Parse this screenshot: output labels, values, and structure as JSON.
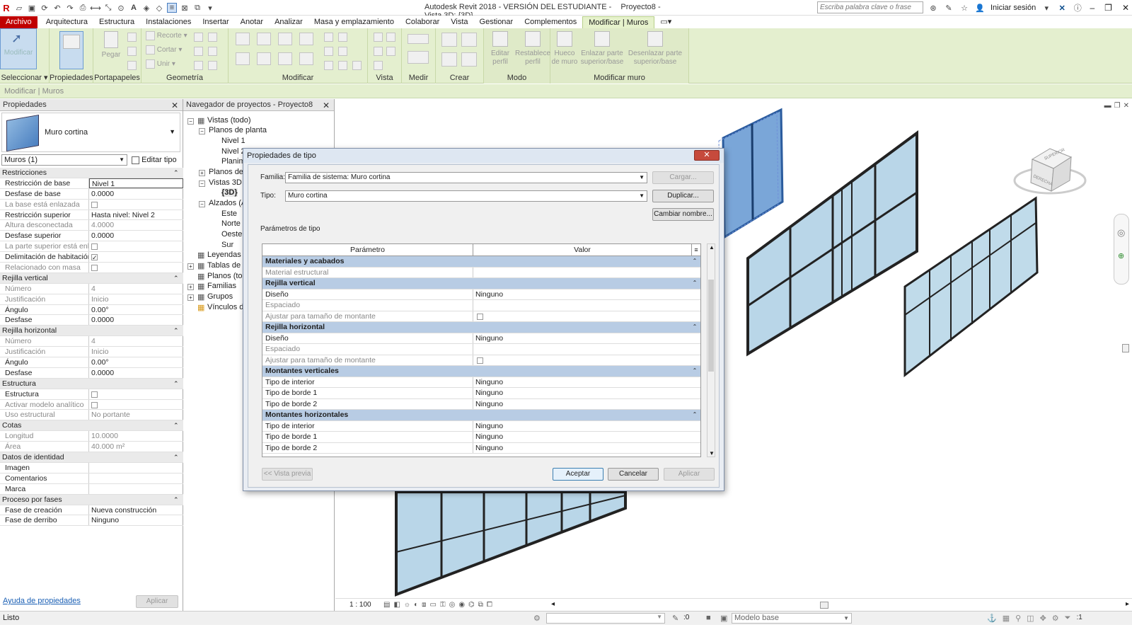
{
  "title": {
    "app": "Autodesk Revit 2018 - VERSIÓN DEL ESTUDIANTE -",
    "doc": "Proyecto8 - Vista 3D: {3D}",
    "search_placeholder": "Escriba palabra clave o frase",
    "signin": "Iniciar sesión"
  },
  "menu": {
    "tabs": [
      "Archivo",
      "Arquitectura",
      "Estructura",
      "Instalaciones",
      "Insertar",
      "Anotar",
      "Analizar",
      "Masa y emplazamiento",
      "Colaborar",
      "Vista",
      "Gestionar",
      "Complementos",
      "Modificar | Muros"
    ],
    "active_index": 12
  },
  "ribbon": {
    "modify_label": "Modificar",
    "groups": {
      "select": "Seleccionar ▾",
      "properties": "Propiedades",
      "clipboard": "Portapapeles",
      "geometry": "Geometría",
      "modify": "Modificar",
      "view": "Vista",
      "measure": "Medir",
      "create": "Crear",
      "mode": "Modo",
      "modify_wall": "Modificar muro"
    },
    "buttons": {
      "paste": "Pegar",
      "cut_profile": "Recorte",
      "cut": "Cortar",
      "join": "Unir",
      "edit_profile": [
        "Editar",
        "perfil"
      ],
      "reset_profile": [
        "Restablecer",
        "perfil"
      ],
      "wall_opening": [
        "Hueco",
        "de muro"
      ],
      "attach": [
        "Enlazar parte",
        "superior/base"
      ],
      "detach": [
        "Desenlazar parte",
        "superior/base"
      ]
    },
    "context_label": "Modificar | Muros"
  },
  "properties": {
    "title": "Propiedades",
    "type_name": "Muro cortina",
    "instance_filter": "Muros (1)",
    "edit_type": "Editar tipo",
    "rows": [
      {
        "g": "Restricciones"
      },
      {
        "n": "Restricción de base",
        "v": "Nivel 1"
      },
      {
        "n": "Desfase de base",
        "v": "0.0000"
      },
      {
        "n": "La base está enlazada",
        "chk": false,
        "grey": true
      },
      {
        "n": "Restricción superior",
        "v": "Hasta nivel: Nivel 2"
      },
      {
        "n": "Altura desconectada",
        "v": "4.0000",
        "grey": true
      },
      {
        "n": "Desfase superior",
        "v": "0.0000"
      },
      {
        "n": "La parte superior está enl...",
        "chk": false,
        "grey": true
      },
      {
        "n": "Delimitación de habitación",
        "chk": true
      },
      {
        "n": "Relacionado con masa",
        "chk": false,
        "grey": true
      },
      {
        "g": "Rejilla vertical"
      },
      {
        "n": "Número",
        "v": "4",
        "grey": true
      },
      {
        "n": "Justificación",
        "v": "Inicio",
        "grey": true
      },
      {
        "n": "Ángulo",
        "v": "0.00°"
      },
      {
        "n": "Desfase",
        "v": "0.0000"
      },
      {
        "g": "Rejilla horizontal"
      },
      {
        "n": "Número",
        "v": "4",
        "grey": true
      },
      {
        "n": "Justificación",
        "v": "Inicio",
        "grey": true
      },
      {
        "n": "Ángulo",
        "v": "0.00°"
      },
      {
        "n": "Desfase",
        "v": "0.0000"
      },
      {
        "g": "Estructura"
      },
      {
        "n": "Estructura",
        "chk": false
      },
      {
        "n": "Activar modelo analítico",
        "chk": false,
        "grey": true
      },
      {
        "n": "Uso estructural",
        "v": "No portante",
        "grey": true
      },
      {
        "g": "Cotas"
      },
      {
        "n": "Longitud",
        "v": "10.0000",
        "grey": true
      },
      {
        "n": "Área",
        "v": "40.000 m²",
        "grey": true
      },
      {
        "g": "Datos de identidad"
      },
      {
        "n": "Imagen",
        "v": ""
      },
      {
        "n": "Comentarios",
        "v": ""
      },
      {
        "n": "Marca",
        "v": ""
      },
      {
        "g": "Proceso por fases"
      },
      {
        "n": "Fase de creación",
        "v": "Nueva construcción"
      },
      {
        "n": "Fase de derribo",
        "v": "Ninguno"
      }
    ],
    "help_link": "Ayuda de propiedades",
    "apply": "Aplicar"
  },
  "browser": {
    "title": "Navegador de proyectos - Proyecto8",
    "nodes": [
      "Vistas (todo)",
      "Planos de planta",
      "Nivel 1",
      "Nivel 2",
      "Planim",
      "Planos de",
      "Vistas 3D",
      "{3D}",
      "Alzados (A",
      "Este",
      "Norte",
      "Oeste",
      "Sur",
      "Leyendas",
      "Tablas de p",
      "Planos (tod",
      "Familias",
      "Grupos",
      "Vínculos de"
    ]
  },
  "dialog": {
    "title": "Propiedades de tipo",
    "family_label": "Familia:",
    "family_value": "Familia de sistema: Muro cortina",
    "type_label": "Tipo:",
    "type_value": "Muro cortina",
    "load": "Cargar...",
    "duplicate": "Duplicar...",
    "rename": "Cambiar nombre...",
    "params_label": "Parámetros de tipo",
    "col_param": "Parámetro",
    "col_value": "Valor",
    "rows": [
      {
        "g": "Materiales y acabados"
      },
      {
        "n": "Material estructural",
        "v": "",
        "grey": true
      },
      {
        "g": "Rejilla vertical"
      },
      {
        "n": "Diseño",
        "v": "Ninguno"
      },
      {
        "n": "Espaciado",
        "v": "",
        "grey": true
      },
      {
        "n": "Ajustar para tamaño de montante",
        "chk": true,
        "grey": true
      },
      {
        "g": "Rejilla horizontal"
      },
      {
        "n": "Diseño",
        "v": "Ninguno"
      },
      {
        "n": "Espaciado",
        "v": "",
        "grey": true
      },
      {
        "n": "Ajustar para tamaño de montante",
        "chk": true,
        "grey": true
      },
      {
        "g": "Montantes verticales"
      },
      {
        "n": "Tipo de interior",
        "v": "Ninguno"
      },
      {
        "n": "Tipo de borde 1",
        "v": "Ninguno"
      },
      {
        "n": "Tipo de borde 2",
        "v": "Ninguno"
      },
      {
        "g": "Montantes horizontales"
      },
      {
        "n": "Tipo de interior",
        "v": "Ninguno"
      },
      {
        "n": "Tipo de borde 1",
        "v": "Ninguno"
      },
      {
        "n": "Tipo de borde 2",
        "v": "Ninguno"
      }
    ],
    "preview": "<< Vista previa",
    "ok": "Aceptar",
    "cancel": "Cancelar",
    "apply": "Aplicar"
  },
  "view": {
    "scale": "1 : 100",
    "viewcube_labels": [
      "SUPERIOR",
      "DERECHA"
    ]
  },
  "status": {
    "text": "Listo",
    "coord": ":0",
    "model": "Modelo base",
    "filter": ":1"
  }
}
